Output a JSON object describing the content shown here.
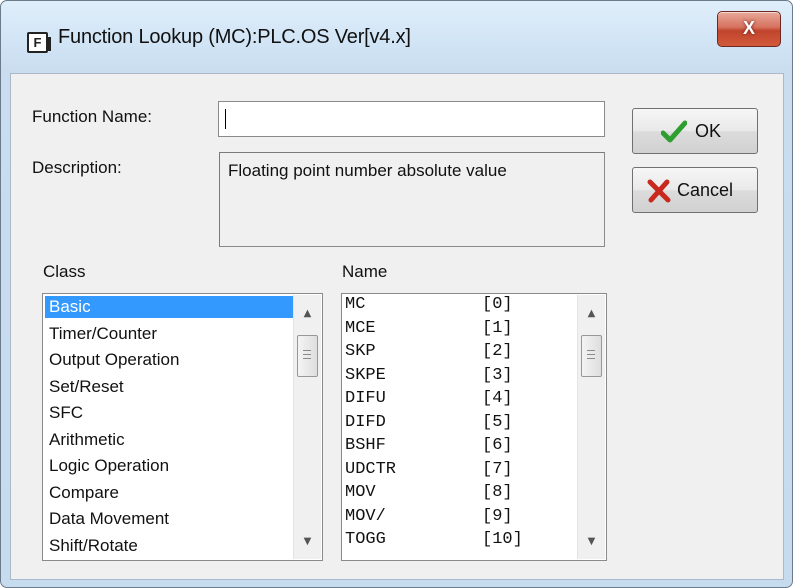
{
  "window": {
    "title": "Function Lookup (MC):PLC.OS Ver[v4.x]",
    "icon_glyph": "F",
    "close_glyph": "X"
  },
  "form": {
    "function_name_label": "Function Name:",
    "function_name_value": "",
    "description_label": "Description:",
    "description_value": "Floating point number absolute value"
  },
  "buttons": {
    "ok_label": "OK",
    "cancel_label": "Cancel"
  },
  "class_list": {
    "label": "Class",
    "selected": "Basic",
    "items": [
      "Basic",
      "Timer/Counter",
      "Output Operation",
      "Set/Reset",
      "SFC",
      "Arithmetic",
      "Logic Operation",
      "Compare",
      "Data Movement",
      "Shift/Rotate"
    ]
  },
  "name_list": {
    "label": "Name",
    "items": [
      {
        "name": "MC",
        "index": "[0]"
      },
      {
        "name": "MCE",
        "index": "[1]"
      },
      {
        "name": "SKP",
        "index": "[2]"
      },
      {
        "name": "SKPE",
        "index": "[3]"
      },
      {
        "name": "DIFU",
        "index": "[4]"
      },
      {
        "name": "DIFD",
        "index": "[5]"
      },
      {
        "name": "BSHF",
        "index": "[6]"
      },
      {
        "name": "UDCTR",
        "index": "[7]"
      },
      {
        "name": "MOV",
        "index": "[8]"
      },
      {
        "name": "MOV/",
        "index": "[9]"
      },
      {
        "name": "TOGG",
        "index": "[10]"
      }
    ]
  },
  "colors": {
    "selection": "#3399ff",
    "ok_check": "#2e9e2e",
    "cancel_x": "#c8281e",
    "close_button": "#c9452d"
  }
}
